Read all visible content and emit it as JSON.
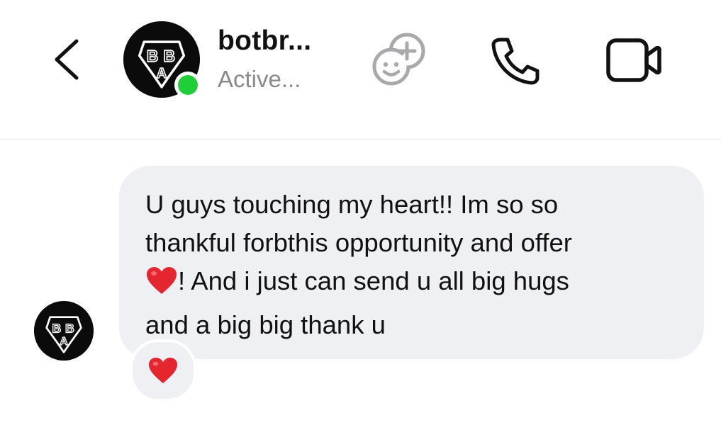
{
  "header": {
    "username": "botbr...",
    "status": "Active...",
    "avatar_icon": "bba-logo-icon",
    "online_color": "#1fcf3a",
    "back_icon": "chevron-left-icon",
    "effects_icon": "add-effect-face-icon",
    "call_icon": "phone-icon",
    "video_icon": "video-camera-icon"
  },
  "messages": [
    {
      "sender_avatar": "bba-logo-icon",
      "text_line_1": "U guys touching my heart!! Im so so",
      "text_line_2": "thankful forbthis opportunity and offer",
      "text_line_3_after_emoji": "! And i just can send u all big hugs",
      "text_line_4": "and a big big thank u",
      "inline_emoji": "red-heart-emoji",
      "reaction": "red-heart-emoji",
      "bubble_color": "#eff0f3"
    }
  ]
}
